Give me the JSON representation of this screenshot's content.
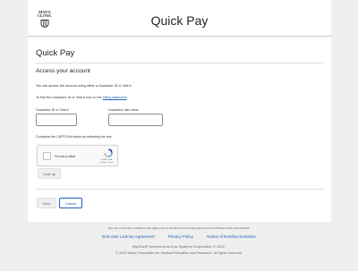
{
  "header": {
    "logo_line1": "MAYO",
    "logo_line2": "CLINIC",
    "title": "Quick Pay"
  },
  "main": {
    "page_title": "Quick Pay",
    "section_title": "Access your account",
    "instruction_1": "You can access the account using either a Guarantor ID or Visit #.",
    "instruction_2_prefix": "To find the Guarantor ID or Visit # look on the ",
    "instruction_2_link": "billing statement",
    "instruction_2_suffix": ".",
    "guarantor_id_label": "Guarantor ID or Visit #",
    "guarantor_id_value": "",
    "guarantor_name_label": "Guarantor last name",
    "guarantor_name_value": "",
    "captcha_instruction": "Complete the CAPTCHA below by selecting the box.",
    "captcha": {
      "label": "I'm not a robot",
      "brand": "reCAPTCHA",
      "terms": "Privacy - Terms",
      "checked": false
    },
    "lookup_label": "Look up",
    "next_label": "Next",
    "cancel_label": "Cancel"
  },
  "footer": {
    "notice": "Any use of this site constitutes your agreement to the End User License Agreement and Privacy Policy linked below.",
    "links": [
      "End User License Agreement",
      "Privacy Policy",
      "Notice of Nondiscrimination"
    ],
    "copyright_1": "MyChart® licensed from Epic Systems Corporation, © 2022.",
    "copyright_2": "© 2022 Mayo Foundation for Medical Education and Research. All rights reserved."
  },
  "colors": {
    "page_background": "#efefef",
    "link": "#1f5fb6",
    "card": "#ffffff"
  }
}
